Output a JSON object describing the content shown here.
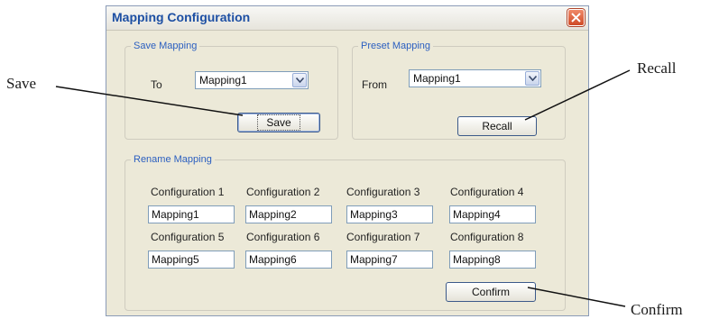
{
  "window": {
    "title": "Mapping Configuration"
  },
  "save_mapping": {
    "legend": "Save Mapping",
    "to_label": "To",
    "to_value": "Mapping1",
    "save_button": "Save"
  },
  "preset_mapping": {
    "legend": "Preset Mapping",
    "from_label": "From",
    "from_value": "Mapping1",
    "recall_button": "Recall"
  },
  "rename_mapping": {
    "legend": "Rename Mapping",
    "configurations": [
      {
        "label": "Configuration 1",
        "value": "Mapping1"
      },
      {
        "label": "Configuration 2",
        "value": "Mapping2"
      },
      {
        "label": "Configuration 3",
        "value": "Mapping3"
      },
      {
        "label": "Configuration 4",
        "value": "Mapping4"
      },
      {
        "label": "Configuration 5",
        "value": "Mapping5"
      },
      {
        "label": "Configuration 6",
        "value": "Mapping6"
      },
      {
        "label": "Configuration 7",
        "value": "Mapping7"
      },
      {
        "label": "Configuration 8",
        "value": "Mapping8"
      }
    ],
    "confirm_button": "Confirm"
  },
  "callouts": {
    "save": "Save",
    "recall": "Recall",
    "confirm": "Confirm"
  },
  "icons": {
    "close": "close-icon",
    "dropdown": "chevron-down-icon"
  },
  "colors": {
    "title": "#1d4fa3",
    "legend": "#2b5fc0",
    "close": "#cf4a26",
    "dialog_bg": "#ece9d8"
  }
}
